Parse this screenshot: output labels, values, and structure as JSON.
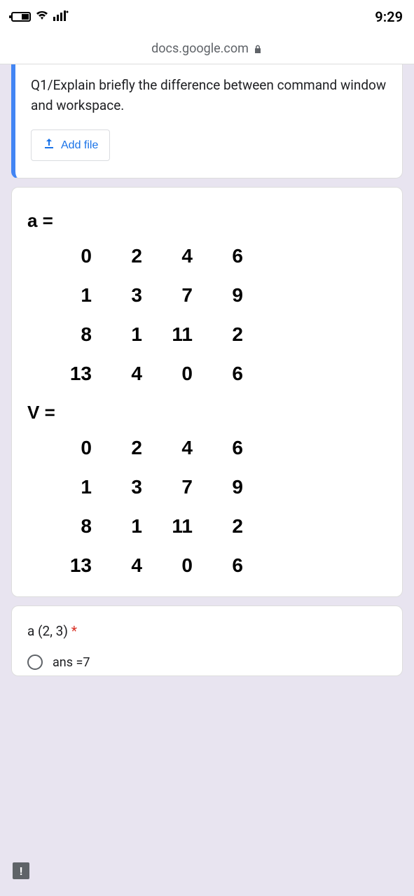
{
  "status": {
    "time": "9:29"
  },
  "browser": {
    "url_text": "docs.google.com"
  },
  "q1": {
    "prompt": "Q1/Explain briefly the difference between command window and workspace.",
    "add_file_label": "Add file"
  },
  "matrix_card": {
    "label_a": "a =",
    "label_v": "V =",
    "matrix_a": [
      [
        "0",
        "2",
        "4",
        "6"
      ],
      [
        "1",
        "3",
        "7",
        "9"
      ],
      [
        "8",
        "1",
        "11",
        "2"
      ],
      [
        "13",
        "4",
        "0",
        "6"
      ]
    ],
    "matrix_v": [
      [
        "0",
        "2",
        "4",
        "6"
      ],
      [
        "1",
        "3",
        "7",
        "9"
      ],
      [
        "8",
        "1",
        "11",
        "2"
      ],
      [
        "13",
        "4",
        "0",
        "6"
      ]
    ]
  },
  "q2": {
    "label": "a (2, 3)",
    "required_mark": "*",
    "option_partial": "ans =7"
  },
  "feedback_badge": "!"
}
